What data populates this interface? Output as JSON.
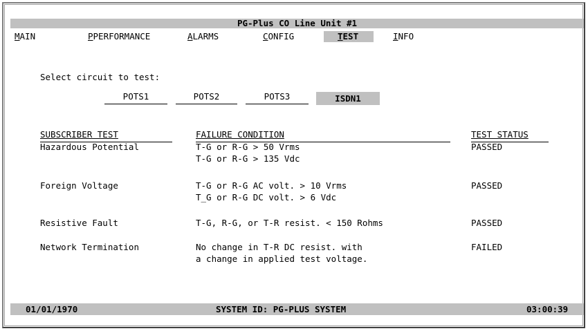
{
  "window": {
    "title": "PG-Plus CO Line Unit #1"
  },
  "menu": [
    {
      "hot": "M",
      "rest": "AIN"
    },
    {
      "hot": "",
      "rest": "PERFORMANCE",
      "hot_pre": "P"
    },
    {
      "hot": "A",
      "rest": "LARMS"
    },
    {
      "hot": "C",
      "rest": "ONFIG"
    },
    {
      "hot": "T",
      "rest": "EST"
    },
    {
      "hot": "I",
      "rest": "NFO"
    }
  ],
  "prompt": "Select circuit to test:",
  "circuits": [
    "POTS1",
    "POTS2",
    "POTS3",
    "ISDN1"
  ],
  "selected_circuit": "ISDN1",
  "table": {
    "headers": {
      "test": "SUBSCRIBER TEST",
      "failure": "FAILURE CONDITION",
      "status": "TEST STATUS"
    },
    "rows": [
      {
        "test": "Hazardous Potential",
        "failure": [
          "T-G or R-G > 50 Vrms",
          "T-G or R-G > 135 Vdc"
        ],
        "status": "PASSED"
      },
      {
        "test": "Foreign Voltage",
        "failure": [
          "T-G or R-G AC volt. > 10 Vrms",
          "T_G or R-G DC volt. > 6 Vdc"
        ],
        "status": "PASSED"
      },
      {
        "test": "Resistive Fault",
        "failure": [
          "T-G, R-G, or T-R resist. < 150 Rohms"
        ],
        "status": "PASSED"
      },
      {
        "test": "Network Termination",
        "failure": [
          "No change in T-R DC resist. with",
          "a change in applied test voltage."
        ],
        "status": "FAILED"
      }
    ]
  },
  "status_bar": {
    "date": "01/01/1970",
    "system_id": "SYSTEM ID: PG-PLUS SYSTEM",
    "time": "03:00:39"
  },
  "colors": {
    "bar": "#c0c0c0",
    "background": "#ffffff"
  }
}
